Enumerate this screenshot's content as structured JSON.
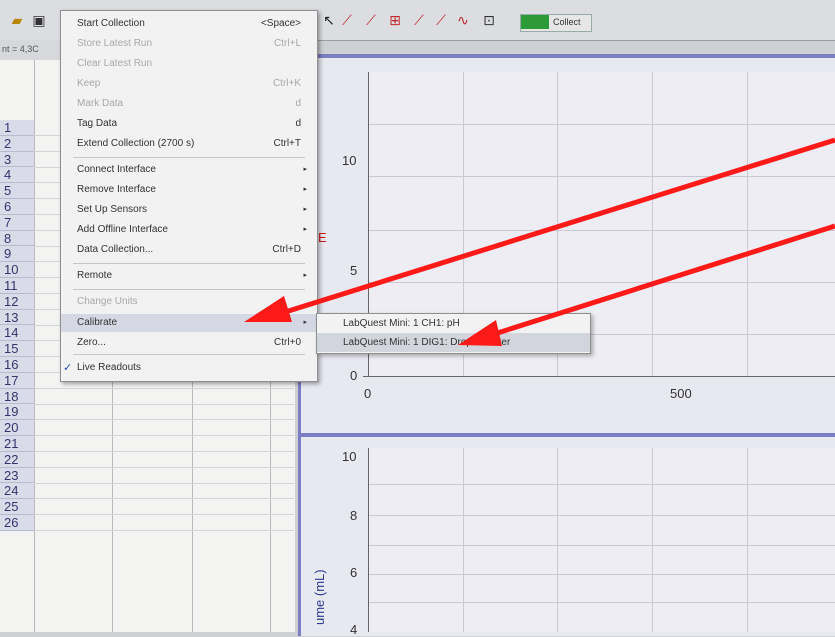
{
  "toolbar": {
    "readout": "nt = 4,3C",
    "collect_label": "Collect",
    "tool_icons": [
      "interpolate-icon",
      "tangent-icon",
      "stats-icon",
      "curve-fit-icon",
      "model-icon",
      "integral-icon",
      "examine-icon"
    ]
  },
  "menu": {
    "items": [
      {
        "label": "Start Collection",
        "shortcut": "<Space>",
        "enabled": true
      },
      {
        "label": "Store Latest Run",
        "shortcut": "Ctrl+L",
        "enabled": false
      },
      {
        "label": "Clear Latest Run",
        "shortcut": "",
        "enabled": false
      },
      {
        "label": "Keep",
        "shortcut": "Ctrl+K",
        "enabled": false
      },
      {
        "label": "Mark Data",
        "shortcut": "d",
        "enabled": false
      },
      {
        "label": "Tag Data",
        "shortcut": "d",
        "enabled": true
      },
      {
        "label": "Extend Collection (2700 s)",
        "shortcut": "Ctrl+T",
        "enabled": true
      },
      {
        "label": "Connect Interface",
        "shortcut": "",
        "enabled": true,
        "submenu": true
      },
      {
        "label": "Remove Interface",
        "shortcut": "",
        "enabled": true,
        "submenu": true
      },
      {
        "label": "Set Up Sensors",
        "shortcut": "",
        "enabled": true,
        "submenu": true
      },
      {
        "label": "Add Offline Interface",
        "shortcut": "",
        "enabled": true,
        "submenu": true
      },
      {
        "label": "Data Collection...",
        "shortcut": "Ctrl+D",
        "enabled": true
      },
      {
        "label": "Remote",
        "shortcut": "",
        "enabled": true,
        "submenu": true
      },
      {
        "label": "Change Units",
        "shortcut": "",
        "enabled": false
      },
      {
        "label": "Calibrate",
        "shortcut": "",
        "enabled": true,
        "submenu": true
      },
      {
        "label": "Zero...",
        "shortcut": "Ctrl+0",
        "enabled": true
      },
      {
        "label": "Live Readouts",
        "shortcut": "",
        "enabled": true,
        "checked": true
      }
    ]
  },
  "submenu": {
    "items": [
      {
        "label": "LabQuest Mini: 1 CH1: pH"
      },
      {
        "label": "LabQuest Mini: 1 DIG1: Drop Counter"
      }
    ]
  },
  "table": {
    "row_numbers": [
      "1",
      "2",
      "3",
      "4",
      "5",
      "6",
      "7",
      "8",
      "9",
      "10",
      "11",
      "12",
      "13",
      "14",
      "15",
      "16",
      "17",
      "18",
      "19",
      "20",
      "21",
      "22",
      "23",
      "24",
      "25",
      "26"
    ]
  },
  "graph_top": {
    "y_ticks": [
      "10",
      "5",
      "0"
    ],
    "x_ticks": [
      "0",
      "500"
    ],
    "y_label_fragment": "E"
  },
  "graph_bottom": {
    "y_ticks": [
      "10",
      "8",
      "6",
      "4"
    ],
    "y_label": "ume (mL)"
  },
  "colors": {
    "arrow": "#ff1a1a",
    "panel_border": "#7b7fc2",
    "collect_green": "#2c9a36"
  }
}
